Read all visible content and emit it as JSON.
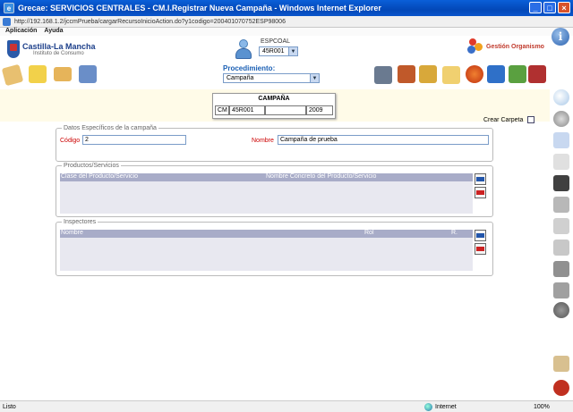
{
  "window": {
    "title": "Grecae: SERVICIOS CENTRALES - CM.I.Registrar Nueva Campaña - Windows Internet Explorer",
    "url": "http://192.168.1.2/jccmPrueba/cargarRecursoInicioAction.do?y1codigo=200401070752ESP98006"
  },
  "menu": {
    "items": [
      "Aplicación",
      "Ayuda"
    ]
  },
  "header": {
    "logo_title": "Castilla-La Mancha",
    "logo_subtitle": "Instituto de Consumo",
    "user_label": "ESPCOAL",
    "user_select": "45R001",
    "gestion_label": "Gestión Organismo"
  },
  "toolbar": {
    "procedimiento_label": "Procedimiento:",
    "procedimiento_value": "Campaña"
  },
  "campaign": {
    "title": "CAMPAÑA",
    "cells": [
      "CM",
      "45R001",
      "",
      "2009"
    ],
    "crear_carpeta_label": "Crear Carpeta"
  },
  "datos": {
    "legend": "Datos Específicos de la campaña",
    "codigo_label": "Código",
    "codigo_value": "2",
    "nombre_label": "Nombre",
    "nombre_value": "Campaña de prueba"
  },
  "productos": {
    "legend": "Productos/Servicios",
    "columns": [
      "Clase del Producto/Servicio",
      "Nombre Concreto del Producto/Servicio"
    ]
  },
  "inspectores": {
    "legend": "Inspectores",
    "columns": [
      "Nombre",
      "Rol",
      "R."
    ]
  },
  "status": {
    "text": "Listo",
    "zone": "Internet",
    "zoom": "100%"
  }
}
